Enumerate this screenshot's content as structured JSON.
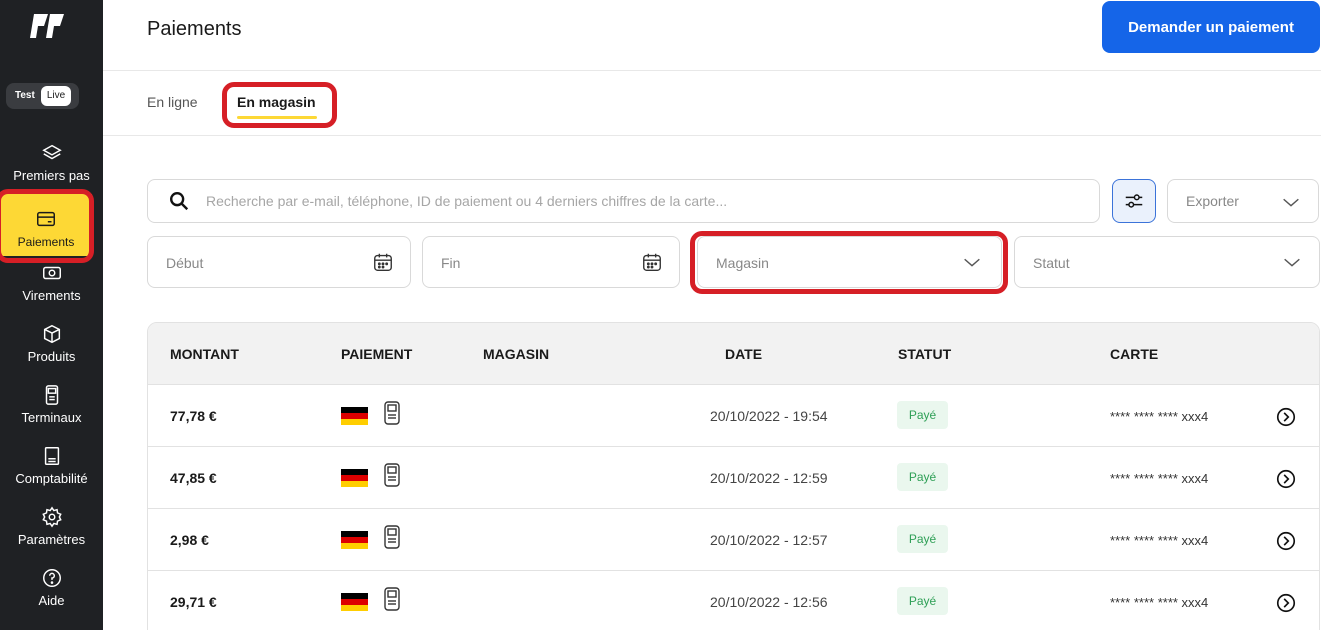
{
  "sidebar": {
    "mode": {
      "test": "Test",
      "live": "Live"
    },
    "items": [
      {
        "label": "Premiers pas",
        "icon": "layers-icon"
      },
      {
        "label": "Paiements",
        "icon": "card-icon"
      },
      {
        "label": "Virements",
        "icon": "cash-icon"
      },
      {
        "label": "Produits",
        "icon": "box-icon"
      },
      {
        "label": "Terminaux",
        "icon": "terminal-icon"
      },
      {
        "label": "Comptabilité",
        "icon": "receipt-icon"
      },
      {
        "label": "Paramètres",
        "icon": "gear-icon"
      },
      {
        "label": "Aide",
        "icon": "help-icon"
      }
    ]
  },
  "header": {
    "title": "Paiements",
    "primary_button": "Demander un paiement"
  },
  "tabs": [
    {
      "label": "En ligne"
    },
    {
      "label": "En magasin"
    }
  ],
  "search": {
    "placeholder": "Recherche par e-mail, téléphone, ID de paiement ou 4 derniers chiffres de la carte..."
  },
  "filters": {
    "export": "Exporter",
    "start": "Début",
    "end": "Fin",
    "store": "Magasin",
    "status": "Statut"
  },
  "table": {
    "headers": [
      "MONTANT",
      "PAIEMENT",
      "MAGASIN",
      "DATE",
      "STATUT",
      "CARTE"
    ],
    "rows": [
      {
        "amount": "77,78 €",
        "store": "",
        "date": "20/10/2022 - 19:54",
        "status": "Payé",
        "card": "**** **** **** xxx4"
      },
      {
        "amount": "47,85 €",
        "store": "",
        "date": "20/10/2022 - 12:59",
        "status": "Payé",
        "card": "**** **** **** xxx4"
      },
      {
        "amount": "2,98 €",
        "store": "",
        "date": "20/10/2022 - 12:57",
        "status": "Payé",
        "card": "**** **** **** xxx4"
      },
      {
        "amount": "29,71 €",
        "store": "",
        "date": "20/10/2022 - 12:56",
        "status": "Payé",
        "card": "**** **** **** xxx4"
      }
    ]
  },
  "colors": {
    "sidebar_bg": "#1f2124",
    "active_nav": "#fdd835",
    "primary": "#1565e8",
    "highlight": "#d61f26",
    "paid_badge_bg": "#eaf7ee",
    "paid_badge_text": "#2e9f56"
  }
}
